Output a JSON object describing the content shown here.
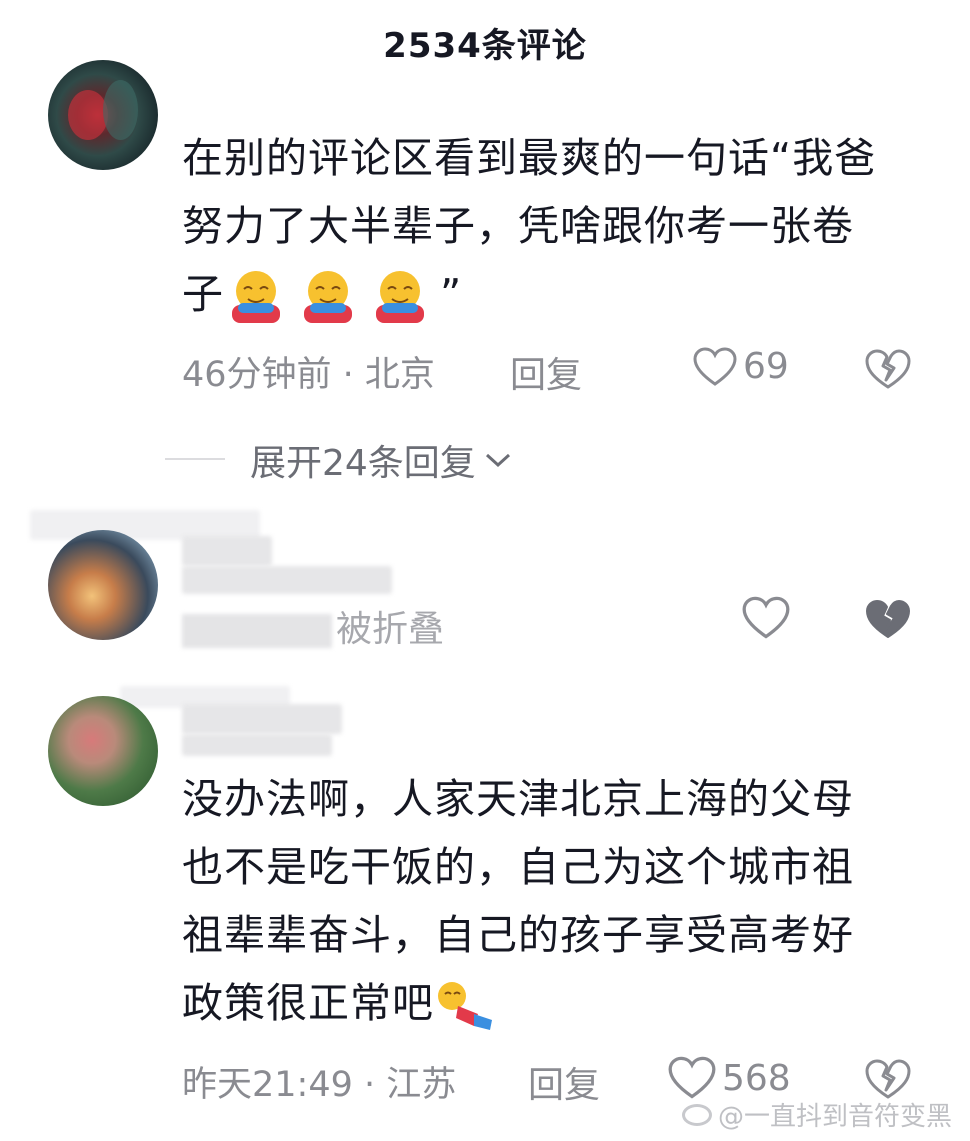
{
  "header": {
    "title": "2534条评论"
  },
  "comments": [
    {
      "text_lines": [
        "在别的评论区看到最爽的一句话“我爸",
        "努力了大半辈子，凭啥跟你考一张卷"
      ],
      "last_line_prefix": "子",
      "last_line_suffix": "”",
      "emoji": [
        "hugging-face-emoji",
        "hugging-face-emoji",
        "hugging-face-emoji"
      ],
      "time_location": "46分钟前 · 北京",
      "reply_label": "回复",
      "likes": "69"
    },
    {
      "collapsed_label": "被折叠"
    },
    {
      "text_lines": [
        "没办法啊，人家天津北京上海的父母",
        "也不是吃干饭的，自己为这个城市祖",
        "祖辈辈奋斗，自己的孩子享受高考好"
      ],
      "last_line_prefix": "政策很正常吧",
      "emoji": [
        "lying-down-emoji"
      ],
      "time_location": "昨天21:49 · 江苏",
      "reply_label": "回复",
      "likes": "568"
    }
  ],
  "expand_replies": "展开24条回复",
  "watermark": "@一直抖到音符变黑",
  "colors": {
    "text": "#161823",
    "meta": "#8a8b91",
    "background": "#ffffff"
  }
}
